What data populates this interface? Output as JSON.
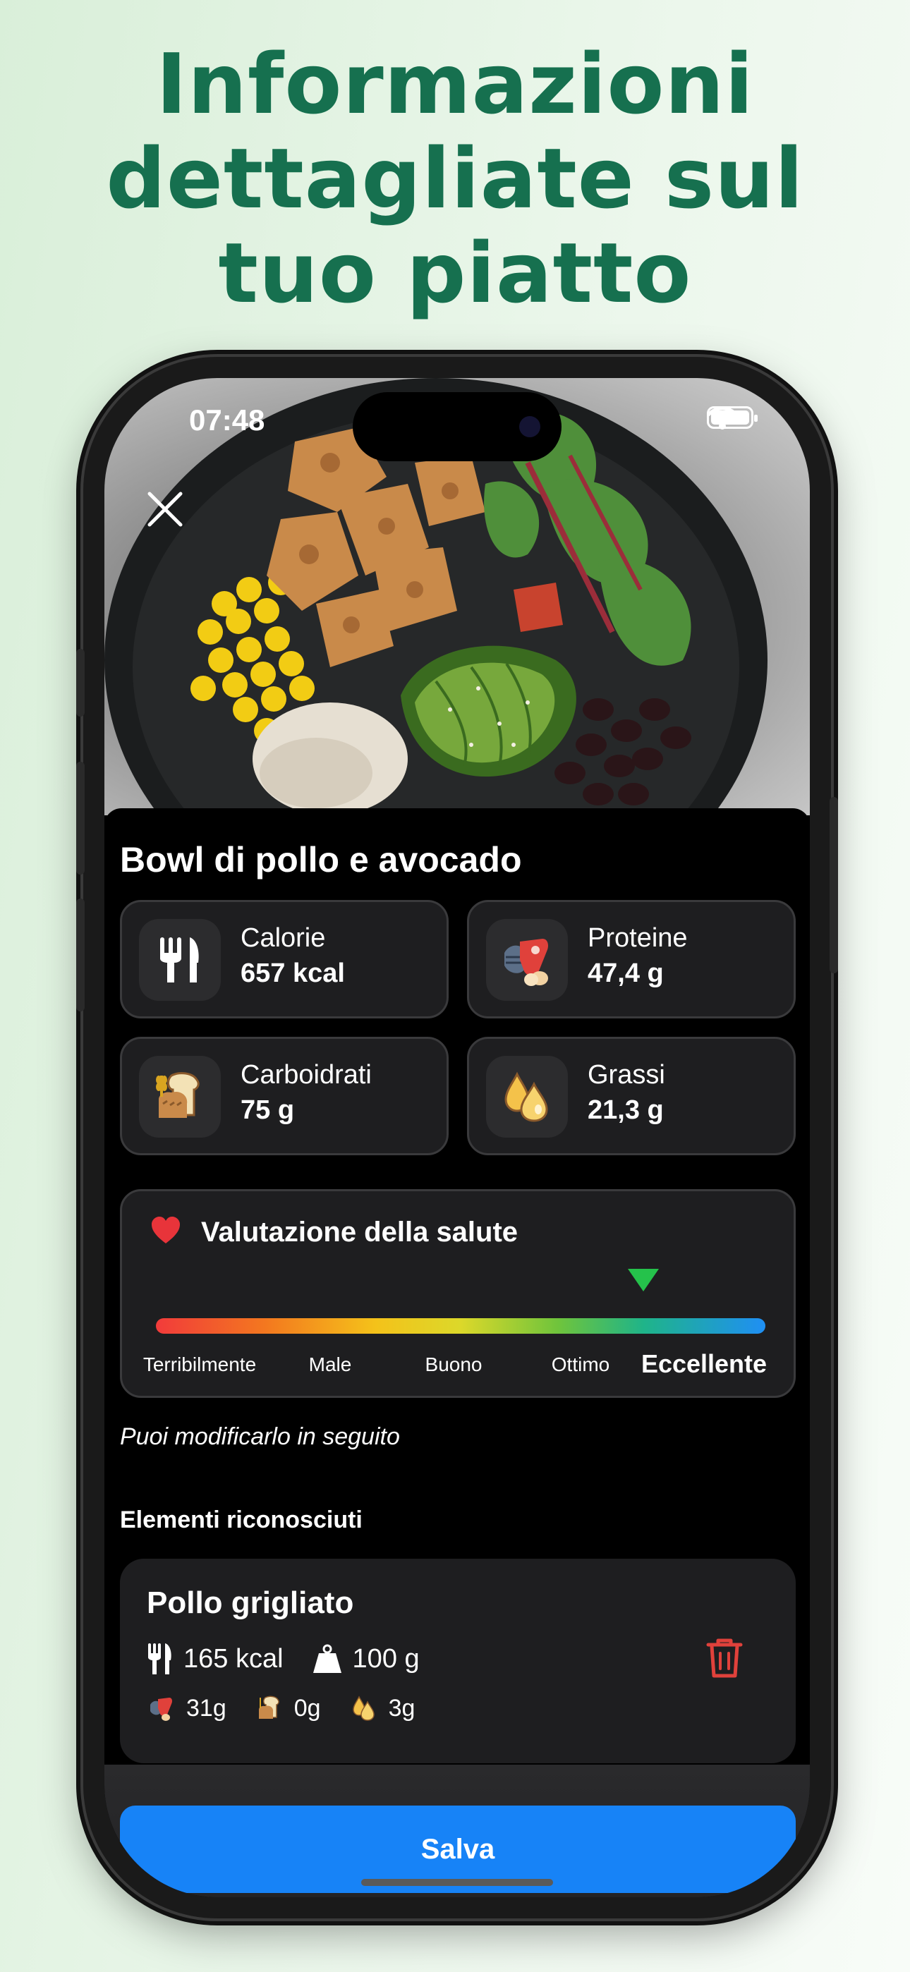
{
  "headline": {
    "line1": "Informazioni",
    "line2": "dettagliate sul",
    "line3": "tuo piatto"
  },
  "status_bar": {
    "time": "07:48"
  },
  "meal": {
    "title": "Bowl di pollo e avocado"
  },
  "macros": {
    "calories": {
      "label": "Calorie",
      "value": "657 kcal",
      "icon": "fork-knife-icon"
    },
    "protein": {
      "label": "Proteine",
      "value": "47,4 g",
      "icon": "protein-icon"
    },
    "carbs": {
      "label": "Carboidrati",
      "value": "75 g",
      "icon": "bread-icon"
    },
    "fat": {
      "label": "Grassi",
      "value": "21,3 g",
      "icon": "fat-drop-icon"
    }
  },
  "health": {
    "title": "Valutazione della salute",
    "labels": [
      "Terribilmente",
      "Male",
      "Buono",
      "Ottimo",
      "Eccellente"
    ],
    "selected": "Eccellente",
    "score_fraction": 0.8,
    "marker_color": "#25c24b"
  },
  "note": "Puoi modificarlo in seguito",
  "recognized": {
    "section_title": "Elementi riconosciuti",
    "items": [
      {
        "name": "Pollo grigliato",
        "kcal": "165 kcal",
        "weight": "100 g",
        "protein": "31g",
        "carbs": "0g",
        "fat": "3g"
      }
    ]
  },
  "actions": {
    "save_label": "Salva"
  },
  "colors": {
    "headline": "#16704f",
    "save_button": "#1783f7",
    "trash": "#e0413b"
  }
}
